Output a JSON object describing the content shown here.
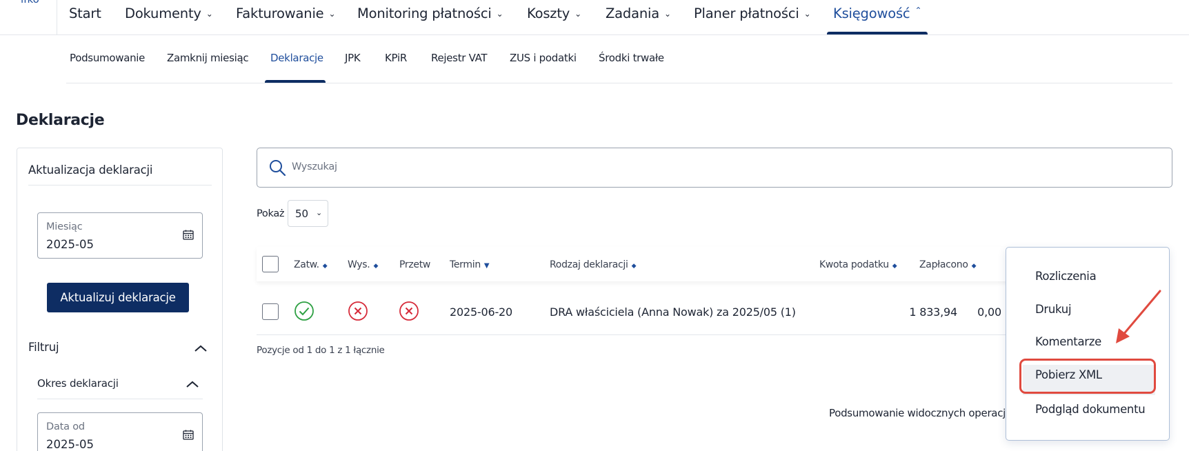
{
  "brand": {
    "text": "ifko"
  },
  "topnav": {
    "items": [
      {
        "label": "Start",
        "has_dropdown": false
      },
      {
        "label": "Dokumenty",
        "has_dropdown": true
      },
      {
        "label": "Fakturowanie",
        "has_dropdown": true
      },
      {
        "label": "Monitoring płatności",
        "has_dropdown": true
      },
      {
        "label": "Koszty",
        "has_dropdown": true
      },
      {
        "label": "Zadania",
        "has_dropdown": true
      },
      {
        "label": "Planer płatności",
        "has_dropdown": true
      },
      {
        "label": "Księgowość",
        "has_dropdown": true,
        "active": true
      }
    ]
  },
  "subnav": {
    "items": [
      {
        "label": "Podsumowanie"
      },
      {
        "label": "Zamknij miesiąc"
      },
      {
        "label": "Deklaracje",
        "active": true
      },
      {
        "label": "JPK"
      },
      {
        "label": "KPiR"
      },
      {
        "label": "Rejestr VAT"
      },
      {
        "label": "ZUS i podatki"
      },
      {
        "label": "Środki trwałe"
      }
    ]
  },
  "page": {
    "title": "Deklaracje"
  },
  "sidebar": {
    "update_title": "Aktualizacja deklaracji",
    "month_field": {
      "label": "Miesiąc",
      "value": "2025-05"
    },
    "update_button": "Aktualizuj deklaracje",
    "filter_label": "Filtruj",
    "period_label": "Okres deklaracji",
    "date_from_field": {
      "label": "Data od",
      "value": "2025-05"
    }
  },
  "search": {
    "placeholder": "Wyszukaj"
  },
  "page_size": {
    "label": "Pokaż",
    "value": "50"
  },
  "table": {
    "headers": {
      "approved": "Zatw.",
      "sent": "Wys.",
      "processed": "Przetw",
      "deadline": "Termin",
      "type": "Rodzaj deklaracji",
      "tax_amount": "Kwota podatku",
      "paid": "Zapłacono"
    },
    "rows": [
      {
        "approved": "yes",
        "sent": "no",
        "processed": "no",
        "deadline": "2025-06-20",
        "type": "DRA właściciela (Anna Nowak) za 2025/05 (1)",
        "tax_amount": "1 833,94",
        "paid": "0,00"
      }
    ],
    "pagination_info": "Pozycje od 1 do 1 z 1 łącznie",
    "summary_text": "Podsumowanie widocznych operacji"
  },
  "context_menu": {
    "items": [
      {
        "label": "Rozliczenia"
      },
      {
        "label": "Drukuj"
      },
      {
        "label": "Komentarze"
      },
      {
        "label": "Pobierz XML",
        "highlighted": true
      },
      {
        "label": "Podgląd dokumentu"
      }
    ]
  },
  "colors": {
    "primary_navy": "#0e2d63",
    "link_blue": "#1f4e9c",
    "success_green": "#2ea043",
    "error_red": "#d62b3a",
    "annotation_red": "#e04a3f"
  },
  "icons": [
    "calendar-icon",
    "search-icon",
    "chevron-down-icon",
    "chevron-up-icon",
    "check-circle-icon",
    "x-circle-icon",
    "sort-icon"
  ]
}
